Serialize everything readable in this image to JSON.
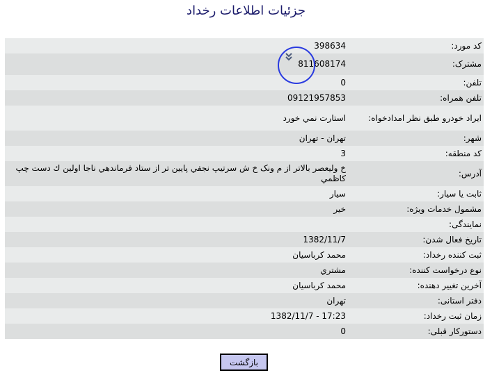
{
  "page": {
    "title": "جزئیات اطلاعات رخداد"
  },
  "rows": [
    {
      "label": "کد مورد:",
      "value": "398634"
    },
    {
      "label": "مشترک:",
      "value": "811608174"
    },
    {
      "label": "تلفن:",
      "value": "0"
    },
    {
      "label": "تلفن همراه:",
      "value": "09121957853"
    },
    {
      "label": "ایراد خودرو طبق نظر امدادخواه:",
      "value": "استارت نمي خورد"
    },
    {
      "label": "شهر:",
      "value": "تهران - تهران"
    },
    {
      "label": "کد منطقه:",
      "value": "3"
    },
    {
      "label": "آدرس:",
      "value": "خ وليعصر بالاتر از م ونک خ ش سرتيپ نجفي پايين تر از ستاد فرماندهي ناجا اولين ك دست چپ كاظمي"
    },
    {
      "label": "ثابت یا سیار:",
      "value": "سيار"
    },
    {
      "label": "مشمول خدمات ویژه:",
      "value": "خیر"
    },
    {
      "label": "نمایندگی:",
      "value": ""
    },
    {
      "label": "تاریخ فعال شدن:",
      "value": "1382/11/7"
    },
    {
      "label": "ثبت کننده رخداد:",
      "value": "محمد کرباسیان"
    },
    {
      "label": "نوع درخواست کننده:",
      "value": "مشتري"
    },
    {
      "label": "آخرین تغییر دهنده:",
      "value": "محمد کرباسیان"
    },
    {
      "label": "دفتر استانی:",
      "value": "تهران"
    },
    {
      "label": "زمان ثبت رخداد:",
      "value": "1382/11/7 - 17:23"
    },
    {
      "label": "دستورکار قبلی:",
      "value": "0"
    }
  ],
  "footer": {
    "back_label": "بازگشت"
  },
  "icons": {
    "expand": "double-chevron-down-icon"
  },
  "colors": {
    "title": "#1b1b6b",
    "row_light": "#e9ebeb",
    "row_dark": "#dcdede",
    "button": "#c6c7f0",
    "annotation": "#2a3be0"
  }
}
